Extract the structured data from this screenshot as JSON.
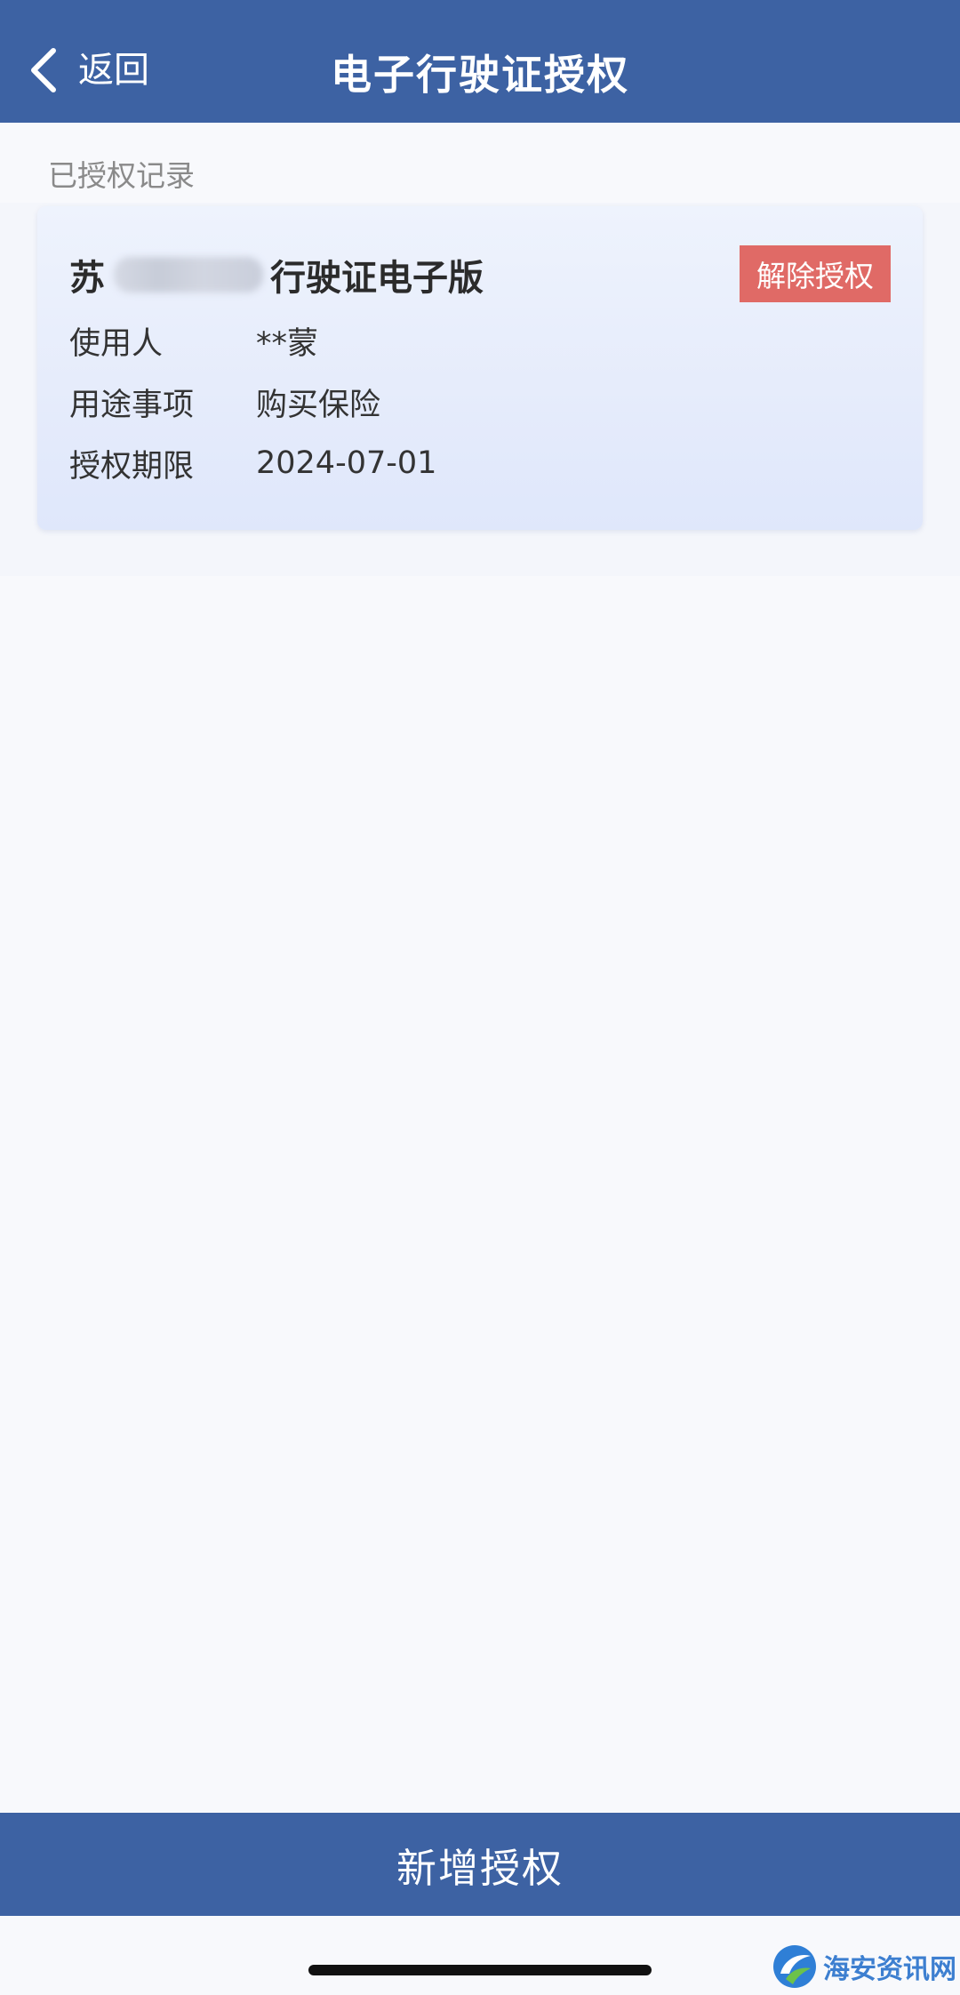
{
  "header": {
    "back_label": "返回",
    "title": "电子行驶证授权"
  },
  "section": {
    "label": "已授权记录"
  },
  "record": {
    "plate_prefix": "苏",
    "plate_suffix_label": "行驶证电子版",
    "revoke_label": "解除授权",
    "fields": [
      {
        "key": "使用人",
        "value": "**蒙"
      },
      {
        "key": "用途事项",
        "value": "购买保险"
      },
      {
        "key": "授权期限",
        "value": "2024-07-01"
      }
    ]
  },
  "footer": {
    "add_label": "新增授权"
  },
  "watermark": {
    "text": "海安资讯网"
  },
  "colors": {
    "brand_blue": "#3d62a3",
    "revoke_red": "#e06a66",
    "page_bg": "#f8f9fc"
  },
  "icons": {
    "back": "chevron-left-icon",
    "watermark": "haian-logo-icon"
  }
}
